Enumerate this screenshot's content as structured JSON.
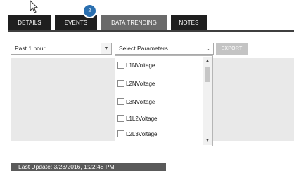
{
  "tabs": {
    "details": "DETAILS",
    "events": "EVENTS",
    "data_trending": "DATA TRENDING",
    "notes": "NOTES",
    "events_badge": "2"
  },
  "filters": {
    "time_range": "Past 1 hour",
    "parameters_placeholder": "Select Parameters",
    "export_label": "EXPORT"
  },
  "parameter_options": [
    {
      "label": "L1NVoltage",
      "checked": false
    },
    {
      "label": "L2NVoltage",
      "checked": false
    },
    {
      "label": "L3NVoltage",
      "checked": false
    },
    {
      "label": "L1L2Voltage",
      "checked": false
    },
    {
      "label": "L2L3Voltage",
      "checked": false
    }
  ],
  "status": {
    "last_update": "Last Update: 3/23/2016, 1:22:48 PM"
  },
  "colors": {
    "tab_dark": "#1f1f1f",
    "tab_active": "#6a6a6a",
    "badge": "#2a6fb0",
    "export_disabled": "#c4c4c4",
    "content_bg": "#e9e9e9",
    "status_bg": "#5a5a5a"
  },
  "icons": {
    "cursor": "mouse-pointer-icon",
    "time_arrow": "chevron-down-icon",
    "param_arrow": "chevron-down-icon",
    "scroll_up": "scroll-up-icon",
    "scroll_down": "scroll-down-icon"
  }
}
